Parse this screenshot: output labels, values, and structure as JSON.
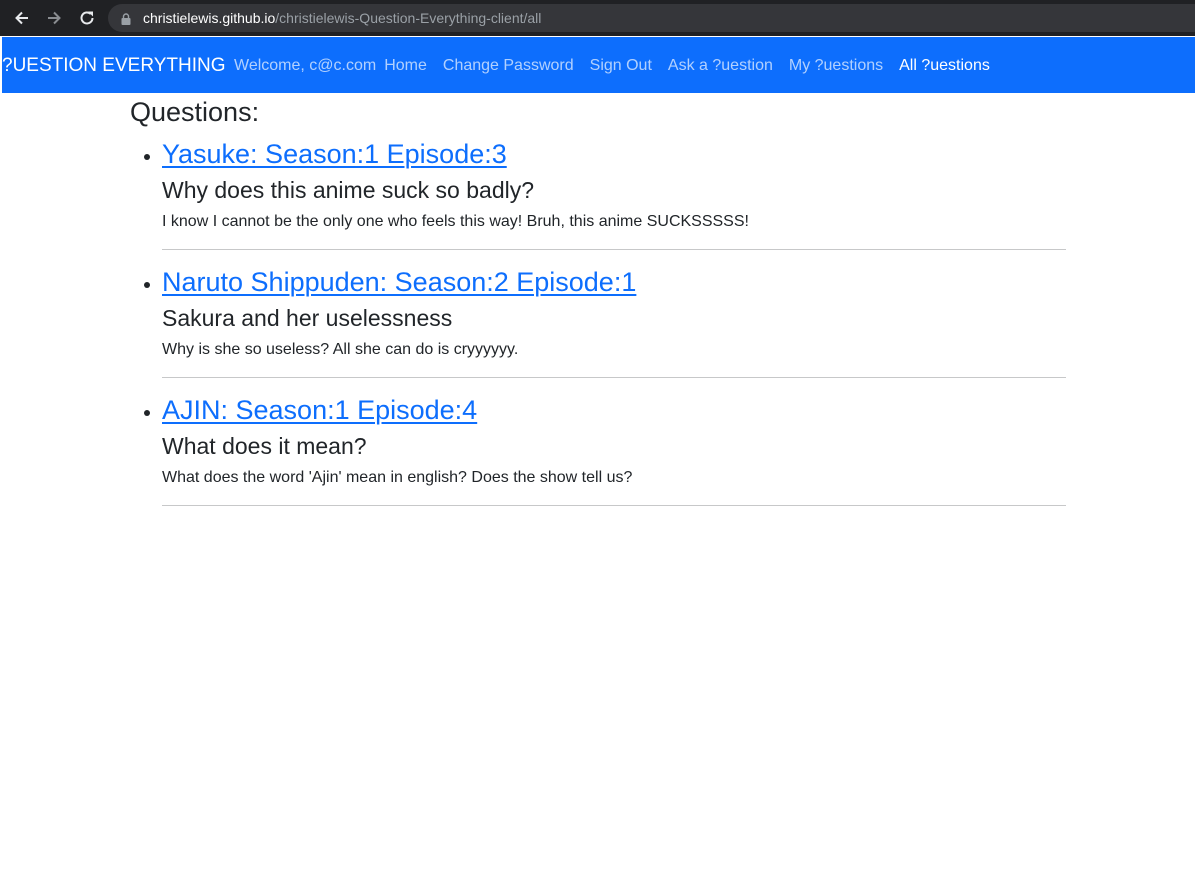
{
  "browser": {
    "url_host": "christielewis.github.io",
    "url_path": "/christielewis-Question-Everything-client/all"
  },
  "nav": {
    "brand": "?UESTION EVERYTHING",
    "welcome": "Welcome, c@c.com",
    "links": [
      "Home",
      "Change Password",
      "Sign Out",
      "Ask a ?uestion",
      "My ?uestions",
      "All ?uestions"
    ],
    "active_link": "All ?uestions",
    "colors": {
      "bar": "#0d6efd",
      "link": "#b8d1fe",
      "active": "#ffffff"
    }
  },
  "main": {
    "heading": "Questions:",
    "questions": [
      {
        "link": "Yasuke: Season:1 Episode:3",
        "title": "Why does this anime suck so badly?",
        "body": "I know I cannot be the only one who feels this way! Bruh, this anime SUCKSSSSS!"
      },
      {
        "link": "Naruto Shippuden: Season:2 Episode:1",
        "title": "Sakura and her uselessness",
        "body": "Why is she so useless? All she can do is cryyyyyy."
      },
      {
        "link": "AJIN: Season:1 Episode:4",
        "title": "What does it mean?",
        "body": "What does the word 'Ajin' mean in english? Does the show tell us?"
      }
    ]
  }
}
